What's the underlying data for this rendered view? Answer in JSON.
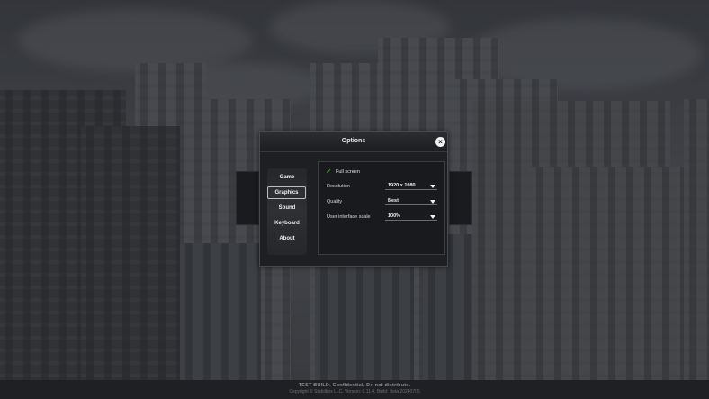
{
  "dialog": {
    "title": "Options",
    "close_symbol": "×"
  },
  "nav": {
    "items": [
      {
        "label": "Game",
        "active": false
      },
      {
        "label": "Graphics",
        "active": true
      },
      {
        "label": "Sound",
        "active": false
      },
      {
        "label": "Keyboard",
        "active": false
      },
      {
        "label": "About",
        "active": false
      }
    ]
  },
  "graphics": {
    "fullscreen": {
      "label": "Full screen",
      "checked": true,
      "check_symbol": "✓"
    },
    "resolution": {
      "label": "Resolution",
      "value": "1920 x 1080"
    },
    "quality": {
      "label": "Quality",
      "value": "Best"
    },
    "ui_scale": {
      "label": "User interface scale",
      "value": "100%"
    }
  },
  "footer": {
    "line1": "TEST BUILD. Confidential. Do not distribute.",
    "line2": "Copyright © Stabilbox LLC. Version: 0.11.4, Build: Beta 20240705"
  },
  "colors": {
    "accent_check": "#38d42f",
    "dialog_bg": "#1e1f22"
  },
  "icons": {
    "close": "close-icon",
    "dropdown": "chevron-down-icon",
    "check": "checkmark-icon"
  }
}
